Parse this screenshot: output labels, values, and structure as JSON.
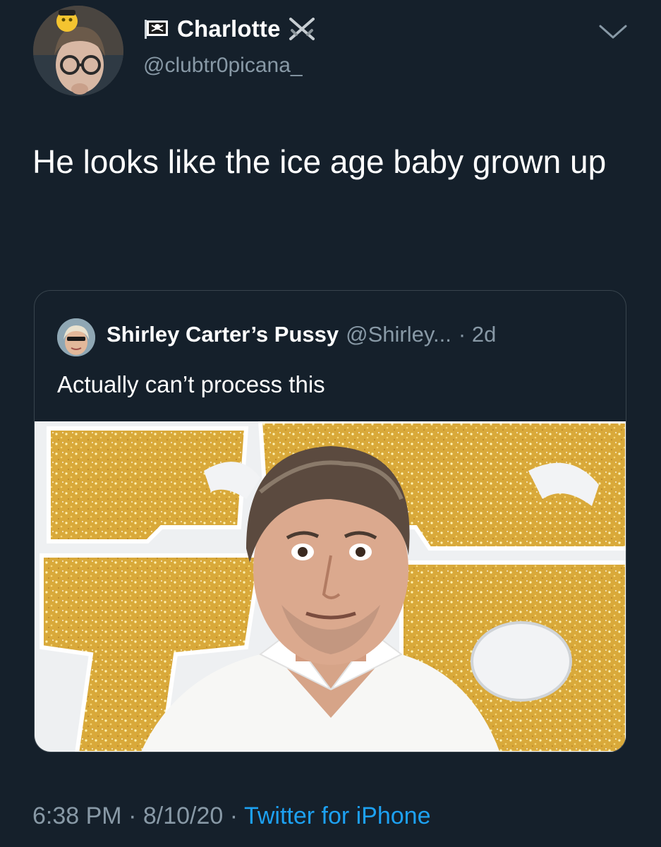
{
  "author": {
    "display_name": "Charlotte",
    "handle": "@clubtr0picana_"
  },
  "tweet": {
    "text": "He looks like the ice age baby grown up",
    "time": "6:38 PM",
    "date": "8/10/20",
    "source": "Twitter for iPhone",
    "separator": "·"
  },
  "quote": {
    "display_name": "Shirley Carter’s Pussy",
    "handle": "@Shirley...",
    "age": "· 2d",
    "text": "Actually can’t process this"
  },
  "colors": {
    "background": "#15202b",
    "secondary_text": "#8899a6",
    "link": "#1da1f2",
    "border": "#38444d"
  },
  "icons": {
    "menu": "chevron-down-icon",
    "name_prefix": "pirate-flag-icon",
    "name_suffix": "crossed-swords-icon"
  }
}
